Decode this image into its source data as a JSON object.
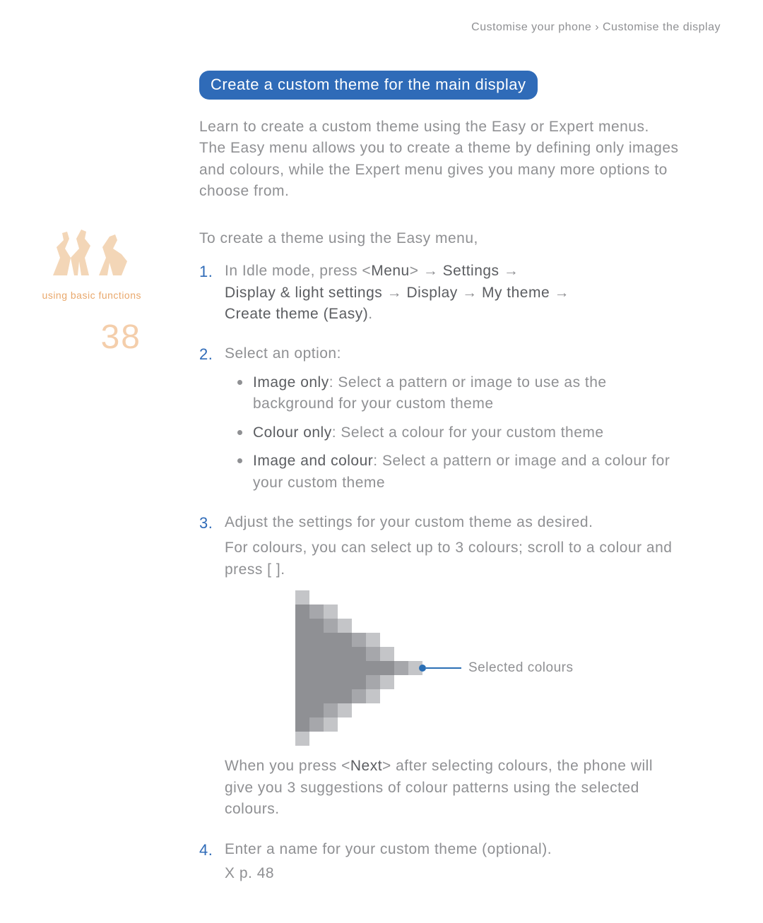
{
  "running_head": {
    "left": "Customise your phone",
    "sep": "›",
    "right": "Customise the display"
  },
  "sidebar": {
    "caption": "using basic functions",
    "page_number": "38"
  },
  "section_title": "Create a custom theme for the main display",
  "intro": "Learn to create a custom theme using the Easy or Expert menus. The Easy menu allows you to create a theme by defining only images and colours, while the Expert menu gives you many more options to choose from.",
  "easy_lead_in": "To create a theme using the Easy menu,",
  "steps": {
    "s1": {
      "prefix": "In Idle mode, press <",
      "menu": "Menu",
      "mid1": "> → ",
      "settings": "Settings",
      "mid2": " → ",
      "display_light": "Display & light settings",
      "mid3": " → ",
      "display": "Display",
      "mid4": " → ",
      "my_theme": "My theme",
      "mid5": " → ",
      "create_easy": "Create theme (Easy)",
      "suffix": "."
    },
    "s2": {
      "lead": "Select an option:",
      "options": {
        "o1_bold": "Image only",
        "o1_rest": ": Select a pattern or image to use as the background for your custom theme",
        "o2_bold": "Colour only",
        "o2_rest": ": Select a colour for your custom theme",
        "o3_bold": "Image and colour",
        "o3_rest": ": Select a pattern or image and a colour for your custom theme"
      }
    },
    "s3": {
      "line1": "Adjust the settings for your custom theme as desired.",
      "line2": "For colours, you can select up to 3 colours; scroll to a colour and press [   ].",
      "callout": "Selected colours",
      "after_fig_a": "When you press <",
      "after_fig_bold": "Next",
      "after_fig_b": "> after selecting colours, the phone will give you 3 suggestions of colour patterns using the selected colours."
    },
    "s4": {
      "line1": "Enter a name for your custom theme (optional).",
      "xref": "X p. 48"
    }
  }
}
